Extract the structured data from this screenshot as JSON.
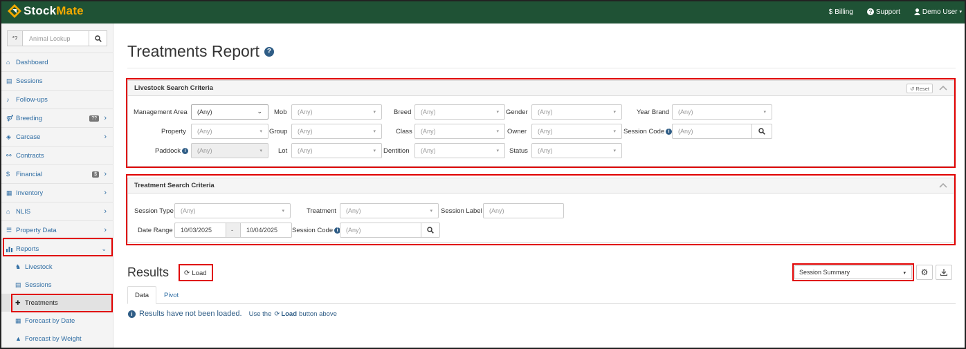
{
  "app": {
    "brand_a": "Stock",
    "brand_b": "Mate"
  },
  "topnav": {
    "billing": "Billing",
    "support": "Support",
    "user": "Demo User"
  },
  "sidebar": {
    "search_prefix": "*?",
    "search_placeholder": "Animal Lookup",
    "items": [
      {
        "label": "Dashboard"
      },
      {
        "label": "Sessions"
      },
      {
        "label": "Follow-ups"
      },
      {
        "label": "Breeding",
        "badge": "??"
      },
      {
        "label": "Carcase"
      },
      {
        "label": "Contracts"
      },
      {
        "label": "Financial",
        "badge": "$"
      },
      {
        "label": "Inventory"
      },
      {
        "label": "NLIS"
      },
      {
        "label": "Property Data"
      },
      {
        "label": "Reports"
      }
    ],
    "reports_sub": [
      {
        "label": "Livestock"
      },
      {
        "label": "Sessions"
      },
      {
        "label": "Treatments"
      },
      {
        "label": "Forecast by Date"
      },
      {
        "label": "Forecast by Weight"
      }
    ]
  },
  "page": {
    "title": "Treatments Report"
  },
  "livestock_panel": {
    "title": "Livestock Search Criteria",
    "reset": "Reset",
    "any": "(Any)",
    "labels": {
      "management_area": "Management Area",
      "property": "Property",
      "paddock": "Paddock",
      "mob": "Mob",
      "group": "Group",
      "lot": "Lot",
      "breed": "Breed",
      "class": "Class",
      "dentition": "Dentition",
      "gender": "Gender",
      "owner": "Owner",
      "status": "Status",
      "year_brand": "Year Brand",
      "session_code": "Session Code"
    }
  },
  "treatment_panel": {
    "title": "Treatment Search Criteria",
    "labels": {
      "session_type": "Session Type",
      "treatment": "Treatment",
      "session_label": "Session Label",
      "date_range": "Date Range",
      "session_code": "Session Code"
    },
    "date_from": "10/03/2025",
    "date_sep": "-",
    "date_to": "10/04/2025"
  },
  "results": {
    "title": "Results",
    "load": "Load",
    "view": "Session Summary",
    "tabs": [
      "Data",
      "Pivot"
    ],
    "msg_main": "Results have not been loaded.",
    "msg_use": "Use the",
    "msg_load": "Load",
    "msg_after": "button above"
  },
  "colors": {
    "header": "#1f5235",
    "accent": "#f2a900",
    "link": "#2f6da3",
    "highlight": "#e00000"
  }
}
